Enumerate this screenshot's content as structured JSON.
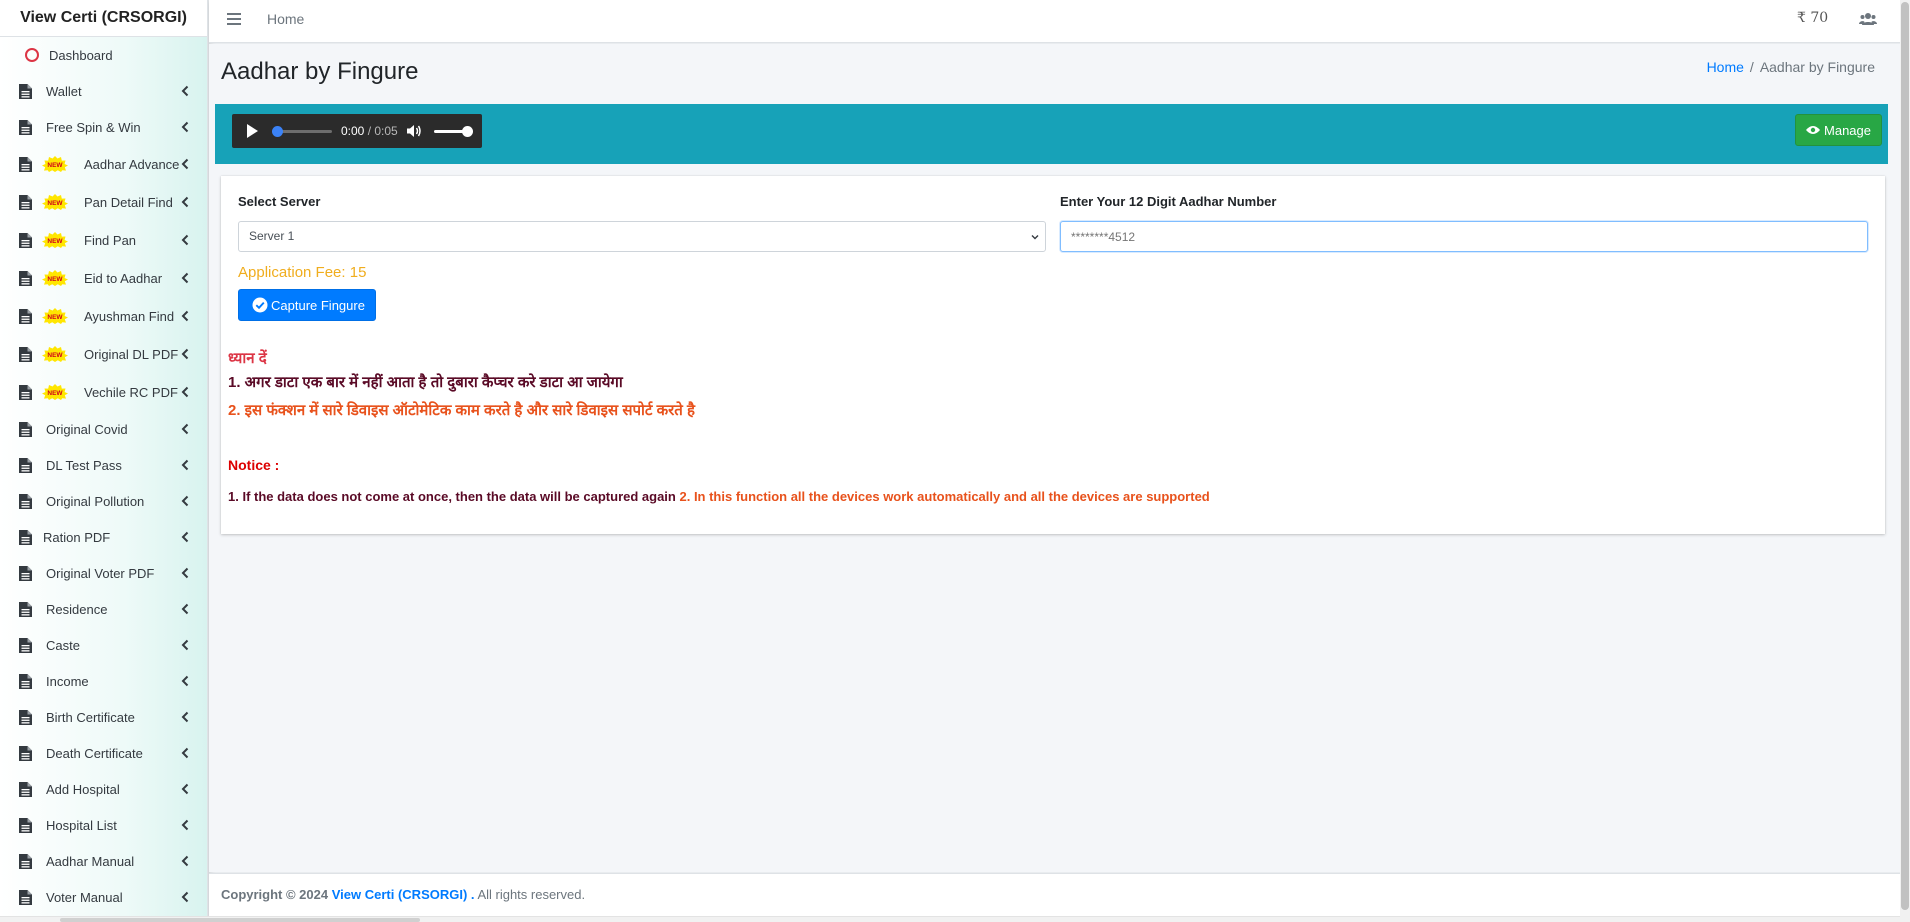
{
  "app": {
    "brand": "View Certi (CRSORGI)"
  },
  "sidebar": {
    "items": [
      {
        "label": "Dashboard",
        "icon": "circle-icon"
      },
      {
        "label": "Wallet",
        "icon": "file-icon"
      },
      {
        "label": "Free Spin & Win",
        "icon": "file-icon"
      },
      {
        "label": "Aadhar Advance",
        "icon": "file-icon",
        "badge": "NEW"
      },
      {
        "label": "Pan Detail Find",
        "icon": "file-icon",
        "badge": "NEW"
      },
      {
        "label": "Find Pan",
        "icon": "file-icon",
        "badge": "NEW"
      },
      {
        "label": "Eid to Aadhar",
        "icon": "file-icon",
        "badge": "NEW"
      },
      {
        "label": "Ayushman Find",
        "icon": "file-icon",
        "badge": "NEW"
      },
      {
        "label": "Original DL PDF",
        "icon": "file-icon",
        "badge": "NEW"
      },
      {
        "label": "Vechile RC PDF",
        "icon": "file-icon",
        "badge": "NEW"
      },
      {
        "label": "Original Covid",
        "icon": "file-icon"
      },
      {
        "label": "DL Test Pass",
        "icon": "file-icon"
      },
      {
        "label": "Original Pollution",
        "icon": "file-icon"
      },
      {
        "label": "Ration PDF",
        "icon": "file-icon"
      },
      {
        "label": "Original Voter PDF",
        "icon": "file-icon"
      },
      {
        "label": "Residence",
        "icon": "file-icon"
      },
      {
        "label": "Caste",
        "icon": "file-icon"
      },
      {
        "label": "Income",
        "icon": "file-icon"
      },
      {
        "label": "Birth Certificate",
        "icon": "file-icon"
      },
      {
        "label": "Death Certificate",
        "icon": "file-icon"
      },
      {
        "label": "Add Hospital",
        "icon": "file-icon"
      },
      {
        "label": "Hospital List",
        "icon": "file-icon"
      },
      {
        "label": "Aadhar Manual",
        "icon": "file-icon"
      },
      {
        "label": "Voter Manual",
        "icon": "file-icon"
      }
    ]
  },
  "topbar": {
    "home_label": "Home",
    "wallet_balance": "₹ 70"
  },
  "page": {
    "title": "Aadhar by Fingure",
    "breadcrumb": {
      "home": "Home",
      "separator": "/",
      "current": "Aadhar by Fingure"
    }
  },
  "audio": {
    "current_time": "0:00",
    "separator": " / ",
    "duration": "0:05"
  },
  "header_actions": {
    "manage_label": "Manage"
  },
  "form": {
    "server_label": "Select Server",
    "server_value": "Server 1",
    "aadhar_label": "Enter Your 12 Digit Aadhar Number",
    "aadhar_placeholder": "********4512",
    "fee_text": "Application Fee: 15",
    "capture_label": "Capture Fingure"
  },
  "notes": {
    "hindi_heading": "ध्यान दें",
    "hindi_line1": "1. अगर डाटा एक बार में नहीं आता है तो दुबारा कैप्चर करे डाटा आ जायेगा",
    "hindi_line2": "2. इस फंक्शन में सारे डिवाइस ऑटोमेटिक काम करते है और सारे डिवाइस सपोर्ट करते है",
    "notice_heading": "Notice :",
    "notice_line1": "1. If the data does not come at once, then the data will be captured again ",
    "notice_line2": "2. In this function all the devices work automatically and all the devices are supported"
  },
  "footer": {
    "copyright": "Copyright © 2024",
    "brand": "View Certi (CRSORGI) .",
    "rights": "All rights reserved."
  },
  "colors": {
    "header_teal": "#17a2b8",
    "manage_green": "#28a745",
    "capture_blue": "#007bff",
    "fee_orange": "#f0ad1e",
    "notice_red": "#dc0000"
  }
}
